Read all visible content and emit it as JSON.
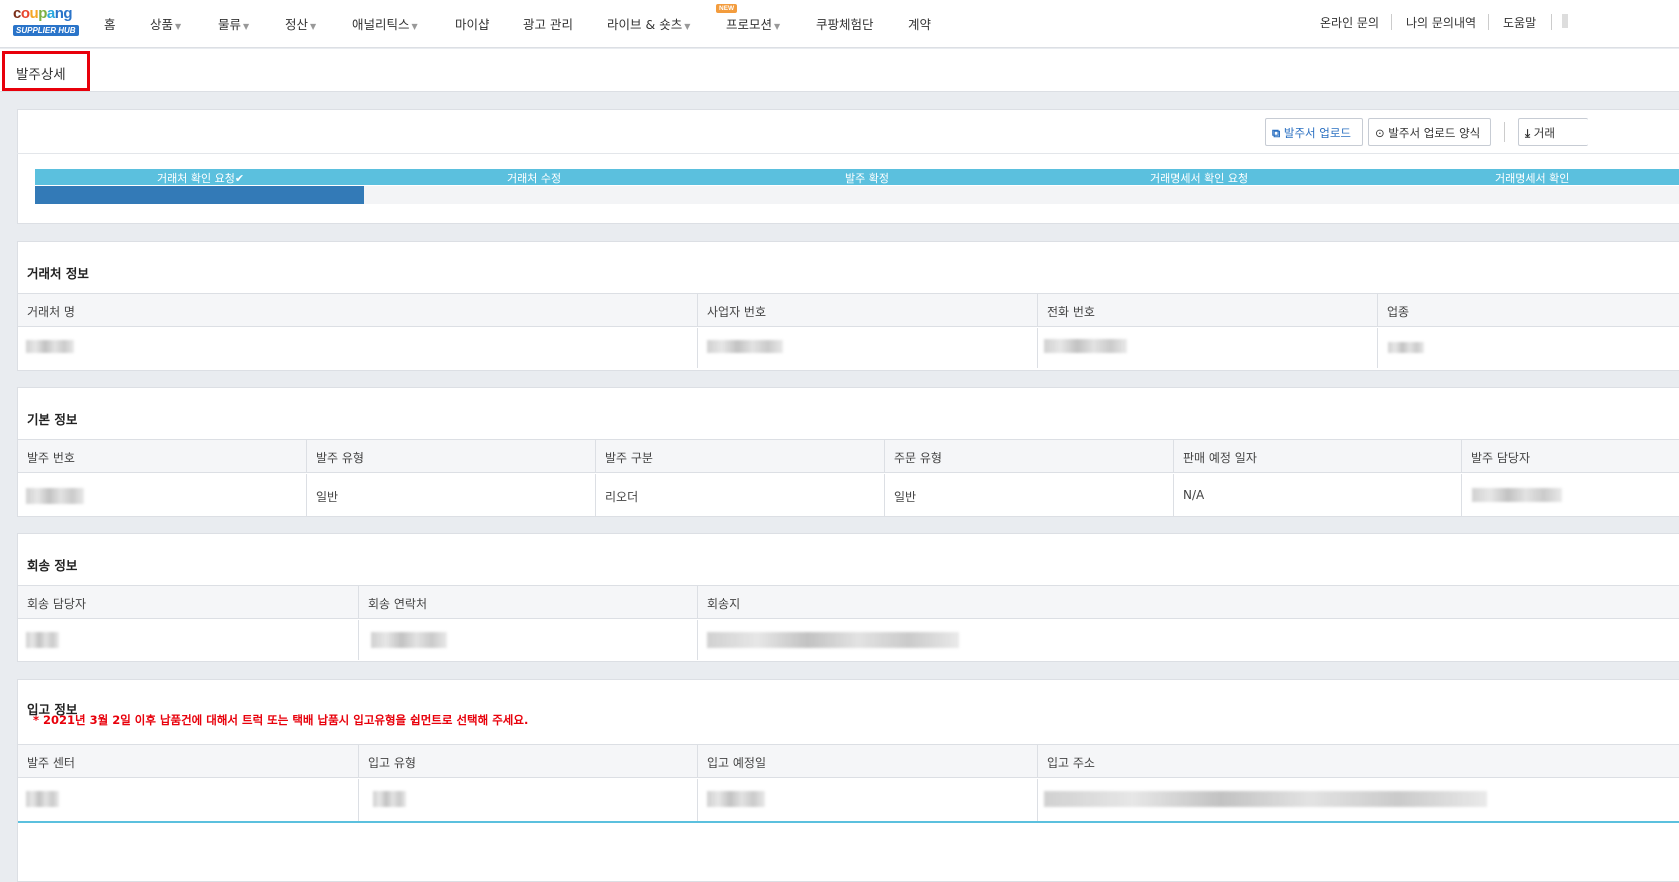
{
  "nav": {
    "logo_word": "coupang",
    "logo_badge": "SUPPLIER HUB",
    "items": [
      {
        "label": "홈"
      },
      {
        "label": "상품"
      },
      {
        "label": "물류"
      },
      {
        "label": "정산"
      },
      {
        "label": "애널리틱스"
      },
      {
        "label": "마이샵"
      },
      {
        "label": "광고 관리"
      },
      {
        "label": "라이브 & 숏츠"
      },
      {
        "label": "프로모션"
      },
      {
        "label": "쿠팡체험단"
      },
      {
        "label": "계약"
      }
    ],
    "new_badge": "NEW",
    "right_links": [
      {
        "label": "온라인 문의"
      },
      {
        "label": "나의 문의내역"
      },
      {
        "label": "도움말"
      }
    ]
  },
  "page": {
    "title": "발주상세"
  },
  "actions": {
    "upload": "발주서 업로드",
    "upload_template": "발주서 업로드 양식",
    "download": "거래"
  },
  "progress": {
    "steps": [
      {
        "label": "거래처 확인 요청✔"
      },
      {
        "label": "거래처 수정"
      },
      {
        "label": "발주 확정"
      },
      {
        "label": "거래명세서 확인 요청"
      },
      {
        "label": "거래명세서 확인"
      }
    ],
    "completed_fraction": 0.2
  },
  "vendor": {
    "title": "거래처 정보",
    "headers": [
      "거래처 명",
      "사업자 번호",
      "전화 번호",
      "업종"
    ]
  },
  "basic": {
    "title": "기본 정보",
    "headers": [
      "발주 번호",
      "발주 유형",
      "발주 구분",
      "주문 유형",
      "판매 예정 일자",
      "발주 담당자"
    ],
    "values": [
      "",
      "일반",
      "리오더",
      "일반",
      "N/A",
      ""
    ]
  },
  "return": {
    "title": "회송 정보",
    "headers": [
      "회송 담당자",
      "회송 연락처",
      "회송지"
    ]
  },
  "inbound": {
    "title": "입고 정보",
    "notice": "* 2021년 3월 2일 이후 납품건에 대해서 트럭 또는 택배 납품시 입고유형을 쉽먼트로 선택해 주세요.",
    "headers": [
      "발주 센터",
      "입고 유형",
      "입고 예정일",
      "입고 주소"
    ]
  },
  "colors": {
    "accent": "#337ab7",
    "step_bar": "#5bc0de",
    "highlight": "#e8000b"
  }
}
